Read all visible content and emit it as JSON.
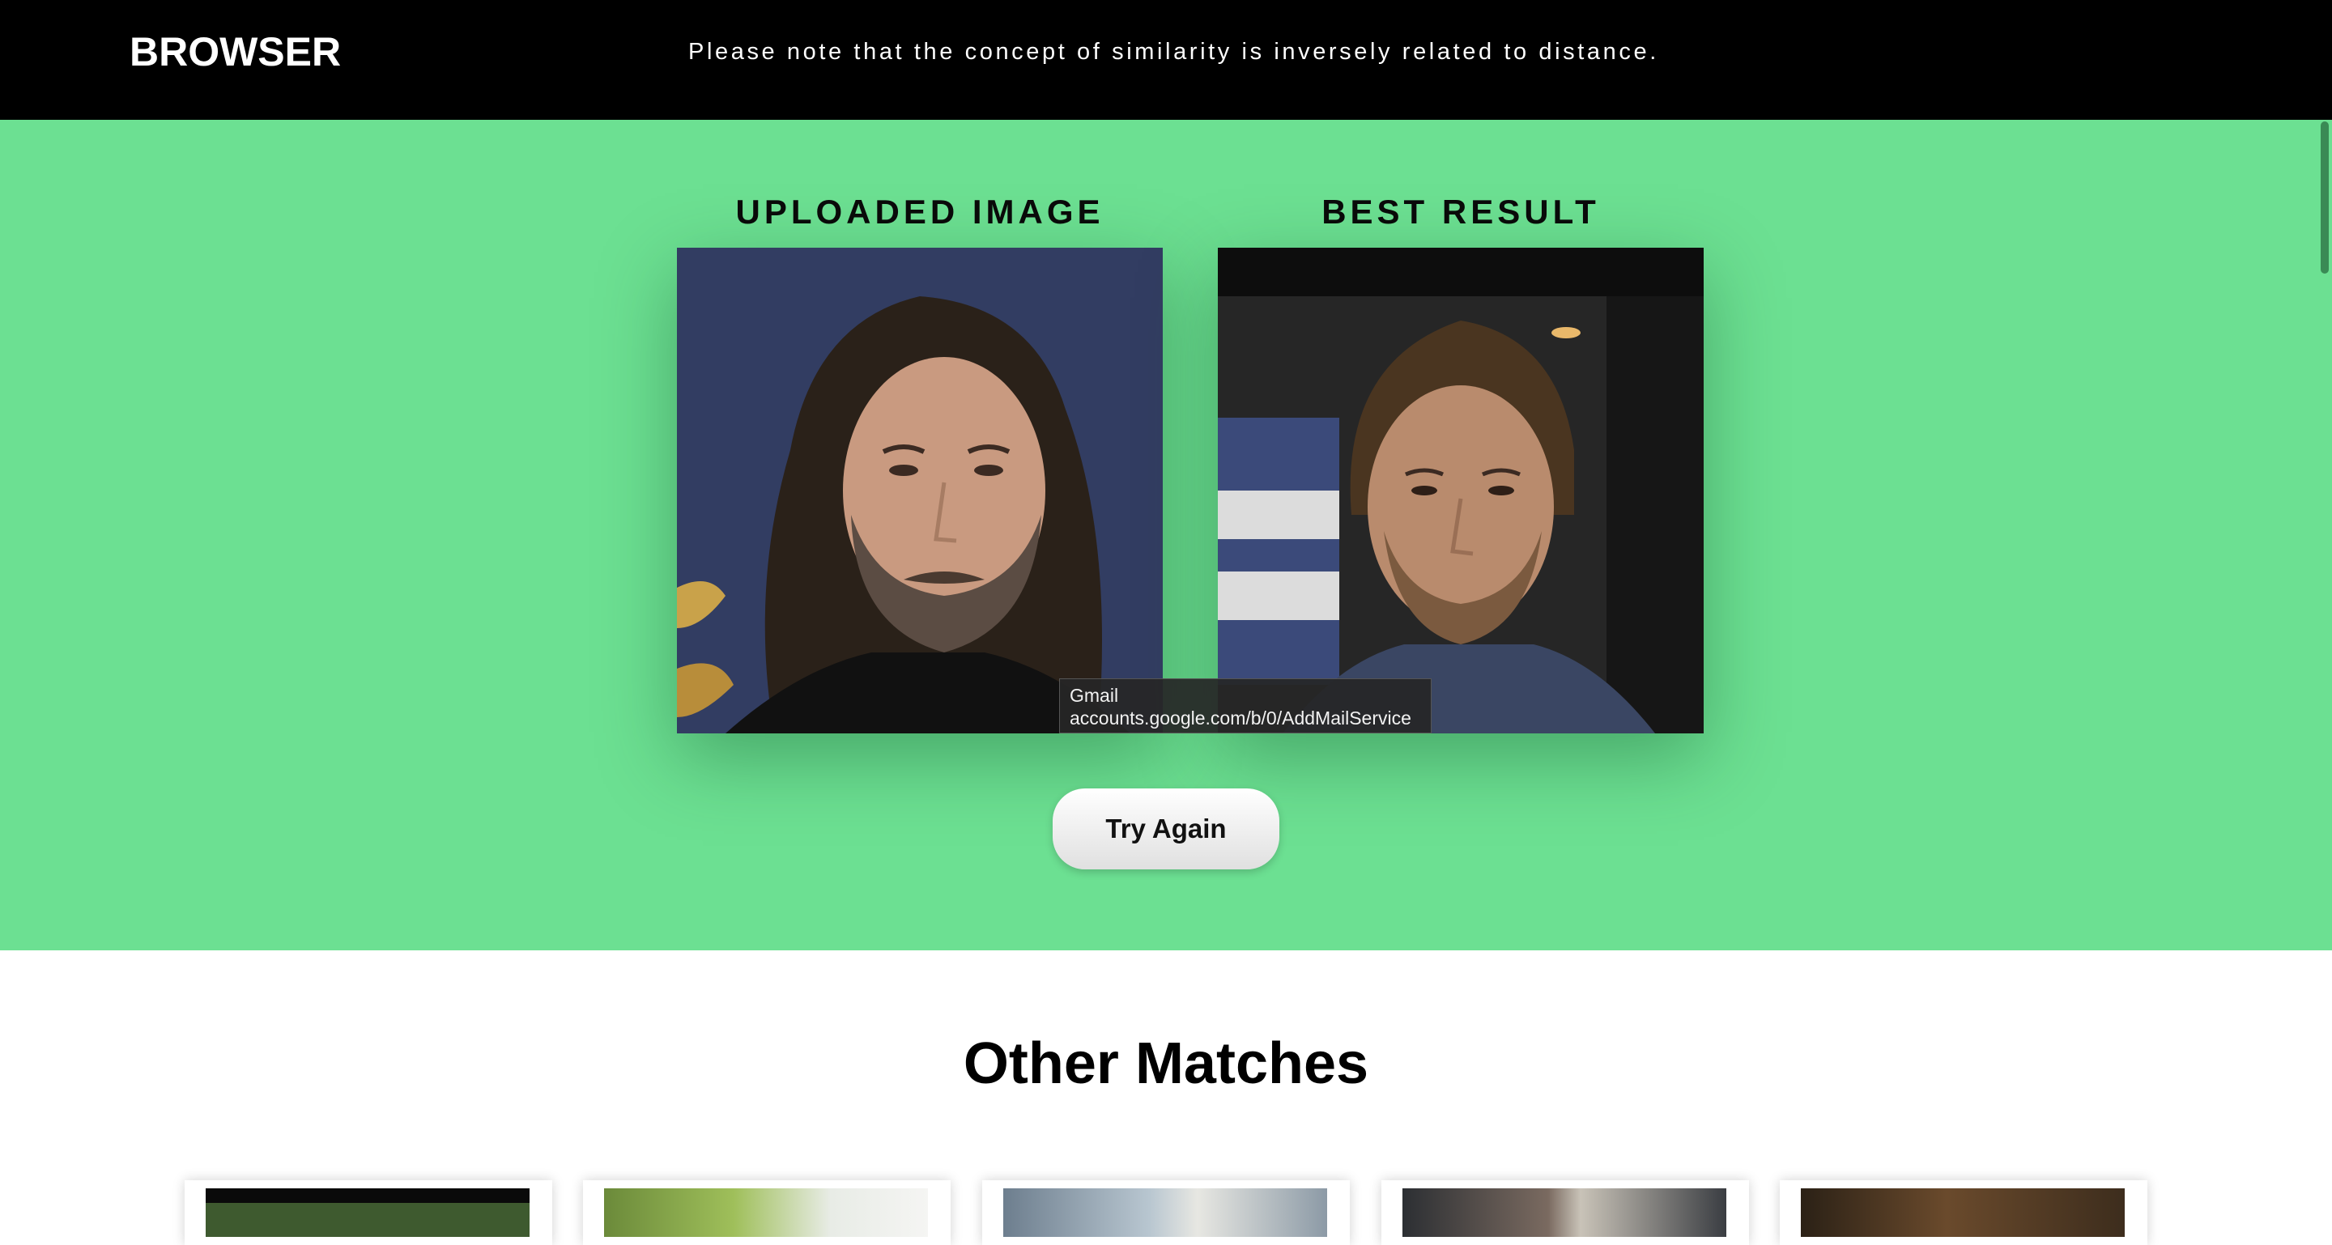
{
  "header": {
    "brand": "BROWSER",
    "notice": "Please note that the concept of similarity is inversely related to distance."
  },
  "hero": {
    "uploaded_title": "UPLOADED IMAGE",
    "best_title": "BEST RESULT",
    "try_again_label": "Try Again",
    "background_color": "#6ce092"
  },
  "tooltip": {
    "title": "Gmail",
    "url": "accounts.google.com/b/0/AddMailService"
  },
  "matches": {
    "title": "Other Matches"
  }
}
